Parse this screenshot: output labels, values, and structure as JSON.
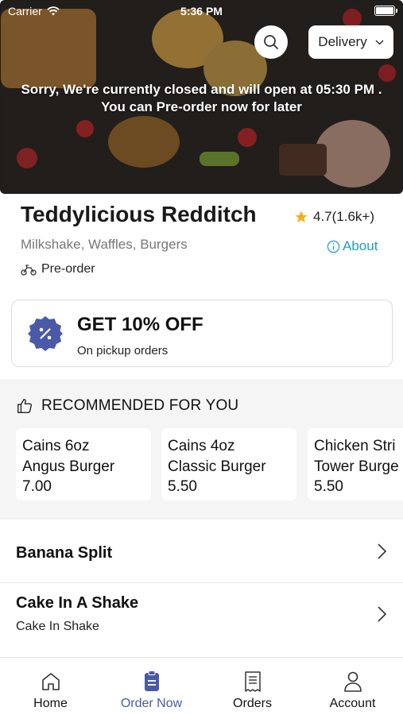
{
  "status_bar": {
    "carrier": "Carrier",
    "time": "5:36 PM"
  },
  "hero": {
    "closed_line1": "Sorry, We're currently closed and will open at 05:30 PM .",
    "closed_line2": "You can Pre-order now for later",
    "delivery_label": "Delivery",
    "search_icon": "search-icon"
  },
  "restaurant": {
    "name": "Teddylicious Redditch",
    "rating": "4.7(1.6k+)",
    "cuisine": "Milkshake, Waffles, Burgers",
    "about_label": "About",
    "preorder_label": "Pre-order"
  },
  "offer": {
    "title": "GET 10% OFF",
    "subtitle": "On pickup orders",
    "badge_color": "#4a5aa8"
  },
  "recommended": {
    "title": "RECOMMENDED FOR YOU",
    "items": [
      {
        "line1": "Cains 6oz",
        "line2": "Angus Burger",
        "price": "7.00"
      },
      {
        "line1": "Cains 4oz",
        "line2": "Classic Burger",
        "price": "5.50"
      },
      {
        "line1": "Chicken Stri",
        "line2": "Tower Burge",
        "price": "5.50"
      }
    ]
  },
  "menu": [
    {
      "title": "Banana Split",
      "subtitle": ""
    },
    {
      "title": "Cake In A Shake",
      "subtitle": "Cake In Shake"
    }
  ],
  "tabs": [
    {
      "label": "Home",
      "icon": "home-icon",
      "active": false
    },
    {
      "label": "Order Now",
      "icon": "order-icon",
      "active": true
    },
    {
      "label": "Orders",
      "icon": "receipt-icon",
      "active": false
    },
    {
      "label": "Account",
      "icon": "account-icon",
      "active": false
    }
  ],
  "colors": {
    "accent": "#4a5aa8",
    "link": "#1f9cc9",
    "star": "#f2b01e"
  }
}
